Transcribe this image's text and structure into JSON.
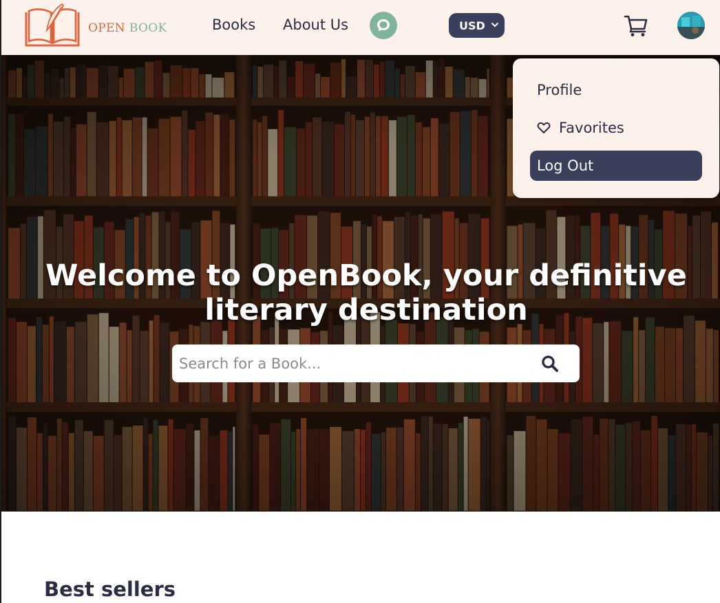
{
  "brand": {
    "open": "OPEN",
    "book": "BOOK"
  },
  "nav": {
    "books": "Books",
    "about": "About Us"
  },
  "currency": {
    "selected": "USD"
  },
  "hero": {
    "title_prefix": "Welcome to ",
    "title_brand": "OpenBook",
    "title_suffix": ", your definitive literary destination"
  },
  "search": {
    "placeholder": "Search for a Book..."
  },
  "user_menu": {
    "profile": "Profile",
    "favorites": "Favorites",
    "logout": "Log Out"
  },
  "sections": {
    "best_sellers": "Best sellers"
  },
  "colors": {
    "header_bg": "#fdf1ec",
    "accent_navy": "#3a3f5c",
    "accent_green": "#7fb59a",
    "brand_orange": "#e4633b"
  },
  "icons": [
    "book-quill-logo-icon",
    "chat-bubble-icon",
    "chevron-down-icon",
    "cart-icon",
    "search-icon",
    "heart-icon"
  ]
}
